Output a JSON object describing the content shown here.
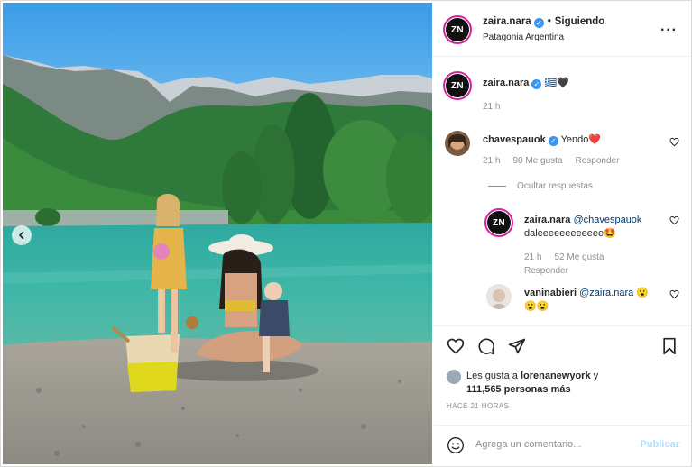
{
  "post": {
    "author": {
      "username": "zaira.nara",
      "avatar_initials": "ZN",
      "follow_status": "Siguiendo",
      "location": "Patagonia Argentina"
    },
    "caption": {
      "username": "zaira.nara",
      "text": "🇬🇷🖤",
      "time": "21 h"
    },
    "comments": [
      {
        "username": "chavespauok",
        "text": "Yendo❤️",
        "time": "21 h",
        "likes": "90 Me gusta",
        "reply_label": "Responder"
      }
    ],
    "hide_replies_label": "Ocultar respuestas",
    "replies": [
      {
        "username": "zaira.nara",
        "mention": "@chavespauok",
        "text": "daleeeeeeeeeeee🤩",
        "time": "21 h",
        "likes": "52 Me gusta",
        "reply_label": "Responder"
      },
      {
        "username": "vaninabieri",
        "mention": "@zaira.nara",
        "text": "😮😮😮"
      }
    ],
    "liked_by_prefix": "Les gusta a",
    "liked_by_user": "lorenanewyork",
    "liked_by_suffix": "y",
    "likes_total": "111,565 personas más",
    "time_ago": "HACE 21 HORAS",
    "comment_placeholder": "Agrega un comentario...",
    "publish_label": "Publicar"
  },
  "colors": {
    "verified_blue": "#3897f0",
    "story_ring": "#d6249f",
    "link_blue": "#00376b",
    "muted": "#8e8e8e",
    "publish_disabled": "#b2dffc"
  },
  "icons": {
    "nav_prev": "chevron-left-icon",
    "more": "more-options-icon",
    "like": "heart-outline-icon",
    "comment": "comment-bubble-icon",
    "share": "paper-plane-icon",
    "save": "bookmark-icon",
    "emoji": "emoji-smile-icon",
    "comment_like": "heart-small-icon"
  }
}
